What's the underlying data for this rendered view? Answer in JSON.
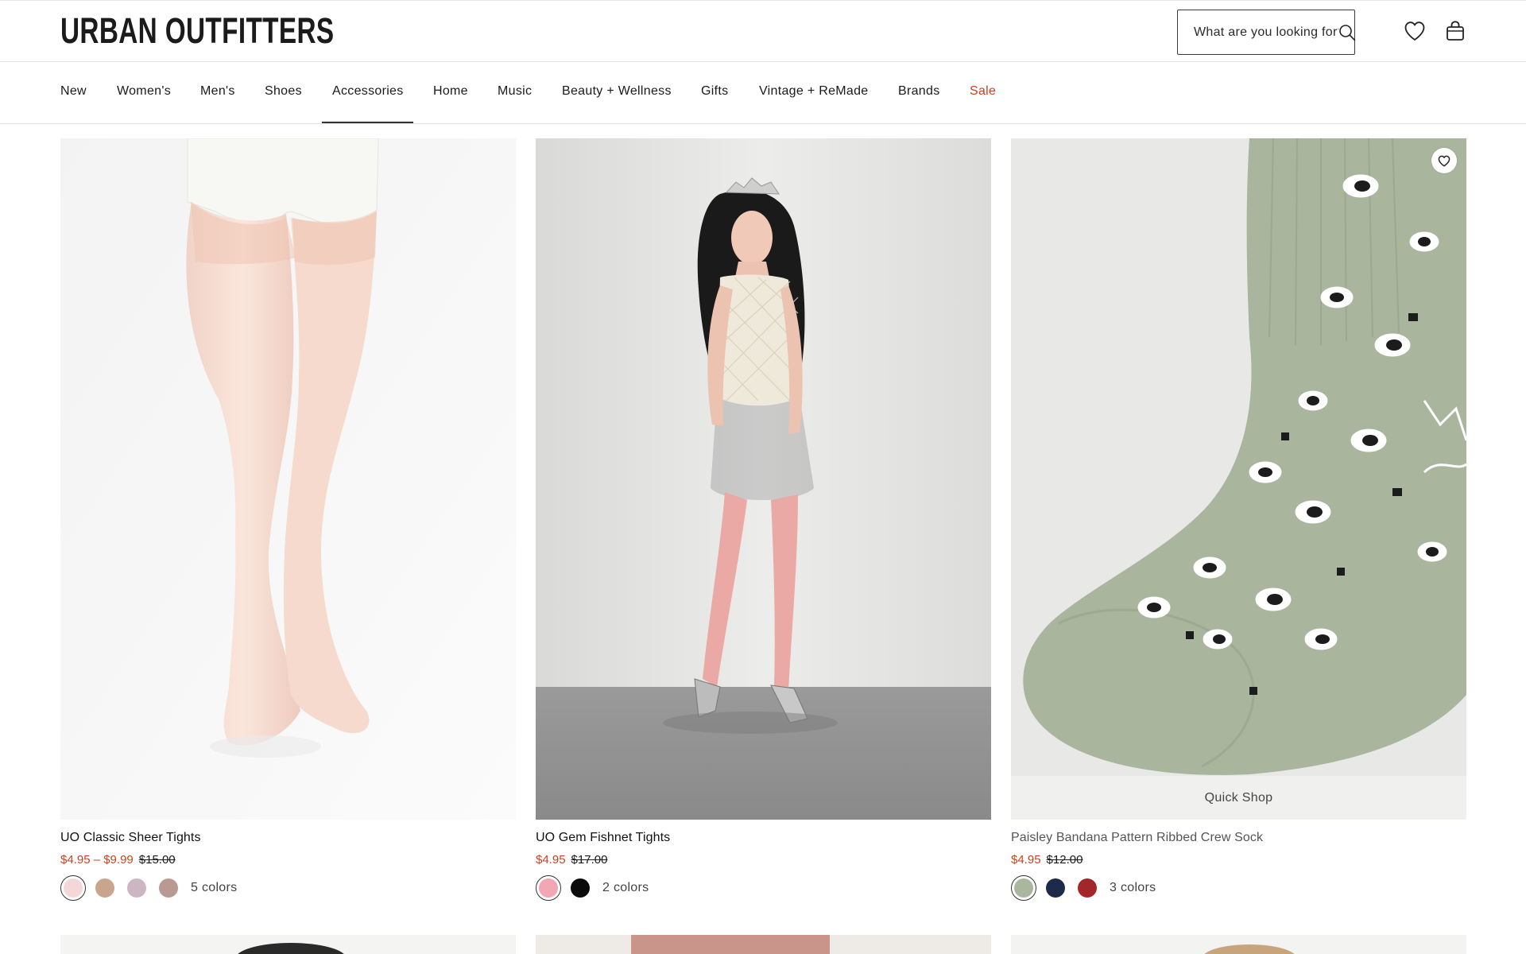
{
  "brand": {
    "logo": "URBAN OUTFITTERS"
  },
  "search": {
    "placeholder": "What are you looking for?",
    "icon": "search-icon"
  },
  "header_icons": [
    "heart-icon",
    "bag-icon"
  ],
  "nav": {
    "items": [
      {
        "label": "New",
        "sale": false
      },
      {
        "label": "Women's",
        "sale": false
      },
      {
        "label": "Men's",
        "sale": false
      },
      {
        "label": "Shoes",
        "sale": false
      },
      {
        "label": "Accessories",
        "sale": false,
        "active": true
      },
      {
        "label": "Home",
        "sale": false
      },
      {
        "label": "Music",
        "sale": false
      },
      {
        "label": "Beauty + Wellness",
        "sale": false
      },
      {
        "label": "Gifts",
        "sale": false
      },
      {
        "label": "Vintage + ReMade",
        "sale": false
      },
      {
        "label": "Brands",
        "sale": false
      },
      {
        "label": "Sale",
        "sale": true
      }
    ]
  },
  "colors": {
    "sale_accent": "#c8431f",
    "text": "#111111"
  },
  "products": [
    {
      "title": "UO Classic Sheer Tights",
      "sale_price": "$4.95 – $9.99",
      "original_price": "$15.00",
      "swatches": [
        "#f4d7d8",
        "#caa58d",
        "#cdb6c3",
        "#b89a92"
      ],
      "colors_label": "5 colors"
    },
    {
      "title": "UO Gem Fishnet Tights",
      "sale_price": "$4.95",
      "original_price": "$17.00",
      "swatches": [
        "#f3a6b3",
        "#0b0b0b"
      ],
      "colors_label": "2 colors"
    },
    {
      "title": "Paisley Bandana Pattern Ribbed Crew Sock",
      "sale_price": "$4.95",
      "original_price": "$12.00",
      "swatches": [
        "#aab79f",
        "#1e2a4a",
        "#a3262b"
      ],
      "colors_label": "3 colors",
      "quick_shop": "Quick Shop"
    }
  ]
}
